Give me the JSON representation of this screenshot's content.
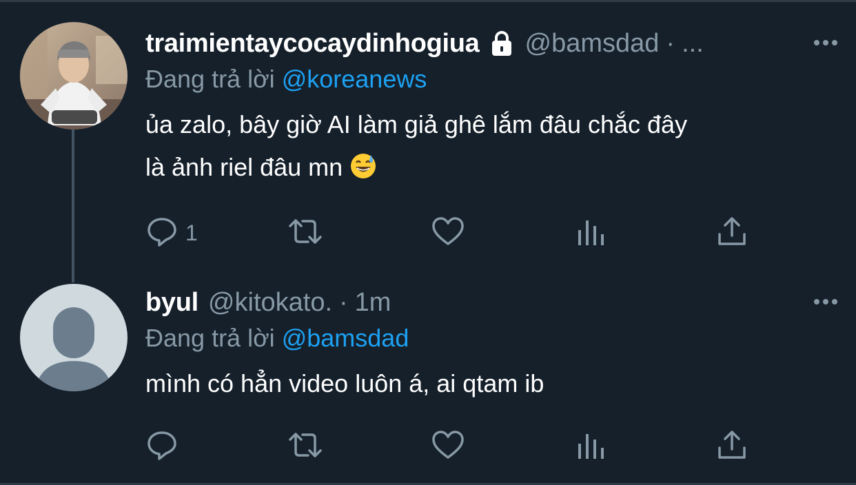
{
  "tweets": [
    {
      "display_name": "traimientaycocaydinhogiua",
      "protected_icon": "lock-icon",
      "handle": "@bamsdad",
      "separator": "·",
      "time": "...",
      "reply_prefix": "Đang trả lời",
      "reply_to": "@koreanews",
      "text_line1": "ủa zalo, bây giờ AI làm giả ghê lắm đâu chắc đây",
      "text_line2": "là ảnh riel đâu mn",
      "emoji": "grinning-face-with-sweat-emoji",
      "reply_count": "1",
      "avatar": "user-photo-avatar"
    },
    {
      "display_name": "byul",
      "handle": "@kitokato.",
      "separator": "·",
      "time": "1m",
      "reply_prefix": "Đang trả lời",
      "reply_to": "@bamsdad",
      "text_line1": "mình có hẳn video luôn á, ai qtam ib",
      "reply_count": "",
      "avatar": "default-profile-avatar"
    }
  ],
  "colors": {
    "background": "#15202b",
    "text_primary": "#ffffff",
    "text_secondary": "#8899a6",
    "link": "#1da1f2",
    "thread_line": "#425462"
  },
  "action_icons": [
    "reply-icon",
    "retweet-icon",
    "like-icon",
    "analytics-icon",
    "share-icon"
  ]
}
